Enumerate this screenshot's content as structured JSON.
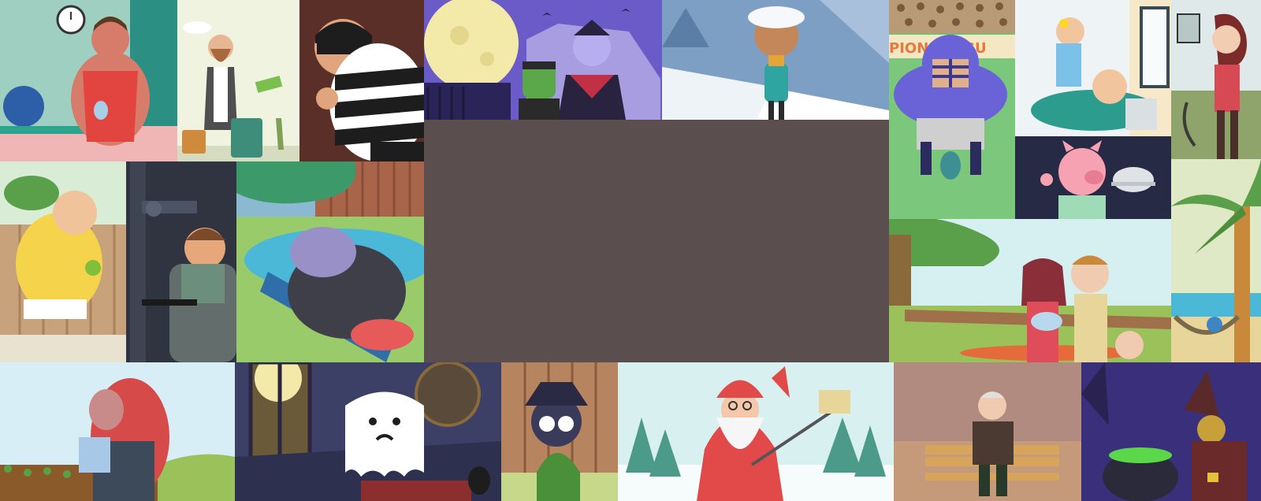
{
  "gallery": {
    "background": "#5b4e4e",
    "tiles": [
      {
        "id": "gym-weightlifter",
        "bg": "#9fcfc0"
      },
      {
        "id": "traveler-ticket",
        "bg": "#eff3df"
      },
      {
        "id": "burglar",
        "bg": "#5a2f28"
      },
      {
        "id": "halloween-vampire",
        "bg": "#6a5bc8"
      },
      {
        "id": "snowy-boy",
        "bg": "#7e9fc4"
      },
      {
        "id": "football-player",
        "bg": "#6fbf6f",
        "banner_text": "PION   LEAGU"
      },
      {
        "id": "dentist-patient",
        "bg": "#eef3f5"
      },
      {
        "id": "woman-vacuum",
        "bg": "#dfe9ea"
      },
      {
        "id": "pig-waiter",
        "bg": "#262a45"
      },
      {
        "id": "fat-man-eating",
        "bg": "#d9ecd6"
      },
      {
        "id": "plumber",
        "bg": "#2f3440"
      },
      {
        "id": "hippo-pool",
        "bg": "#8bb9d2"
      },
      {
        "id": "family-baby",
        "bg": "#d6f0f2"
      },
      {
        "id": "hammock-palm",
        "bg": "#dfe9c6"
      },
      {
        "id": "farmer-watering",
        "bg": "#d8eef6"
      },
      {
        "id": "ghost",
        "bg": "#3c4066"
      },
      {
        "id": "detective-dog",
        "bg": "#a87a5a"
      },
      {
        "id": "santa-selfie",
        "bg": "#d9f0f0"
      },
      {
        "id": "old-man-bench",
        "bg": "#b18a80"
      },
      {
        "id": "witch-cauldron",
        "bg": "#3a2f7a"
      }
    ]
  }
}
